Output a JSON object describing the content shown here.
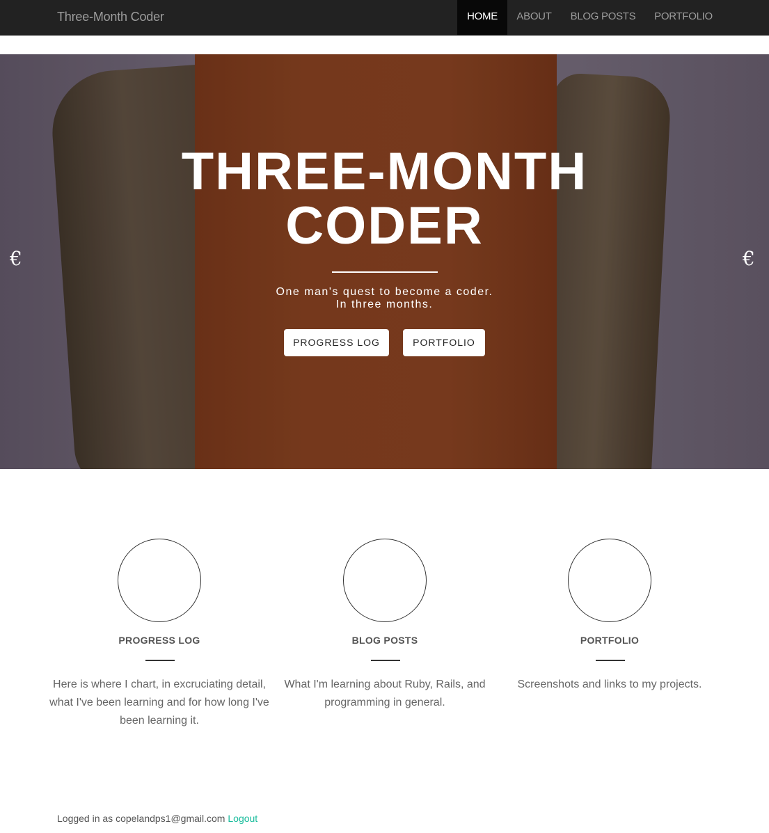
{
  "navbar": {
    "brand": "Three-Month Coder",
    "items": [
      {
        "label": "HOME",
        "active": true
      },
      {
        "label": "ABOUT",
        "active": false
      },
      {
        "label": "BLOG POSTS",
        "active": false
      },
      {
        "label": "PORTFOLIO",
        "active": false
      }
    ]
  },
  "hero": {
    "title_line1": "THREE-MONTH",
    "title_line2": "CODER",
    "subtitle_line1": "One man's quest to become a coder.",
    "subtitle_line2": "In three months.",
    "buttons": {
      "progress_log": "PROGRESS LOG",
      "portfolio": "PORTFOLIO"
    },
    "arrow_prev": "€",
    "arrow_next": "€"
  },
  "features": [
    {
      "title": "PROGRESS LOG",
      "text": "Here is where I chart, in excruciating detail, what I've been learning and for how long I've been learning it."
    },
    {
      "title": "BLOG POSTS",
      "text": "What I'm learning about Ruby, Rails, and programming in general."
    },
    {
      "title": "PORTFOLIO",
      "text": "Screenshots and links to my projects."
    }
  ],
  "footer": {
    "logged_in_text": "Logged in as copelandps1@gmail.com",
    "logout_label": "Logout"
  },
  "colors": {
    "navbar_bg": "#222222",
    "nav_active_bg": "#080808",
    "link_accent": "#18bc9c"
  }
}
